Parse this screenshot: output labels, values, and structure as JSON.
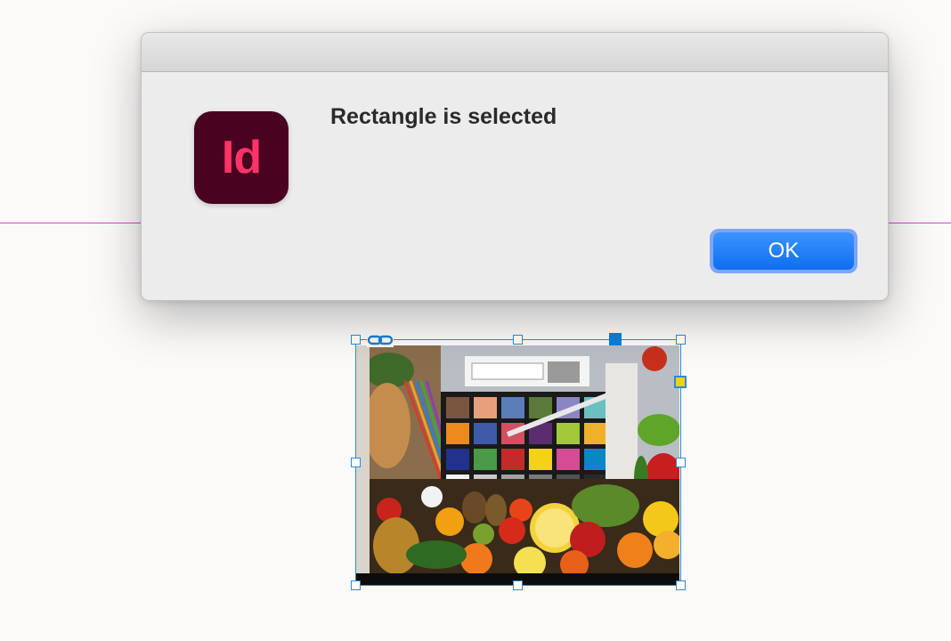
{
  "dialog": {
    "app_icon_text": "Id",
    "message": "Rectangle is selected",
    "ok_label": "OK"
  },
  "icons": {
    "app": "adobe-indesign-icon",
    "link": "link-icon"
  },
  "colors": {
    "guide": "#e23bdc",
    "selection": "#2a8bd8",
    "indesign_bg": "#49021f",
    "indesign_text": "#ff3366",
    "button": "#1577f5"
  }
}
